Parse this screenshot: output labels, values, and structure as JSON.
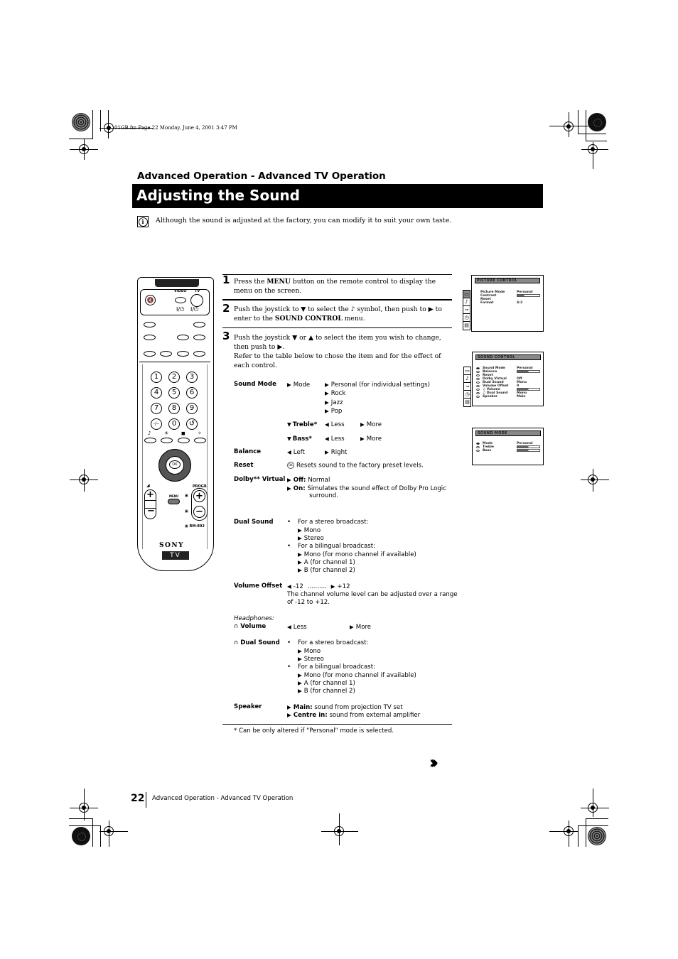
{
  "file_info": "01GB.fm  Page 22  Monday, June 4, 2001  3:47 PM",
  "section_header": "Advanced Operation - Advanced TV Operation",
  "page_title": "Adjusting the Sound",
  "intro": {
    "icon": "info-icon",
    "text": "Although the sound is adjusted at the factory, you can modify it to suit your own taste."
  },
  "steps": [
    {
      "num": "1",
      "pre": "Press the ",
      "bold": "MENU",
      "post": " button on the remote control to display the menu on the screen."
    },
    {
      "num": "2",
      "pre": "Push the joystick to ▼ to select the ♪ symbol, then push to ▶ to enter to the ",
      "bold": "SOUND CONTROL",
      "post": " menu."
    },
    {
      "num": "3",
      "line1": "Push the joystick ▼ or ▲ to select the item you wish to change, then push to ▶.",
      "line2": "Refer to the table below to chose the item and for the effect of each control."
    }
  ],
  "table": {
    "sound_mode": {
      "label": "Sound Mode",
      "mode_label": "Mode",
      "mode_options": [
        "Personal (for individual settings)",
        "Rock",
        "Jazz",
        "Pop"
      ],
      "treble_label": "Treble*",
      "bass_label": "Bass*",
      "less": "Less",
      "more": "More"
    },
    "balance": {
      "label": "Balance",
      "left": "Left",
      "right": "Right"
    },
    "reset": {
      "label": "Reset",
      "text": "Resets sound to the factory preset levels."
    },
    "dolby": {
      "label": "Dolby** Virtual",
      "off_key": "Off:",
      "off_text": "Normal",
      "on_key": "On:",
      "on_text": "Simulates the sound effect of Dolby Pro Logic",
      "on_text2": "surround."
    },
    "dual_sound": {
      "label": "Dual Sound",
      "stereo_head": "For a stereo broadcast:",
      "stereo_options": [
        "Mono",
        "Stereo"
      ],
      "bilingual_head": "For a bilingual broadcast:",
      "bilingual_options": [
        "Mono (for mono channel if available)",
        "A (for channel 1)",
        "B (for channel 2)"
      ]
    },
    "volume_offset": {
      "label": "Volume Offset",
      "range_min": "-12",
      "dots": "..........",
      "range_max": "+12",
      "desc1": "The channel volume level can be adjusted over a range",
      "desc2": "of -12 to +12."
    },
    "headphones": {
      "heading": "Headphones:",
      "volume_label": "Volume",
      "less": "Less",
      "more": "More",
      "dual_label": "Dual Sound",
      "stereo_head": "For a stereo broadcast:",
      "stereo_options": [
        "Mono",
        "Stereo"
      ],
      "bilingual_head": "For a bilingual broadcast:",
      "bilingual_options": [
        "Mono (for mono channel if available)",
        "A (for channel 1)",
        "B (for channel 2)"
      ]
    },
    "speaker": {
      "label": "Speaker",
      "main_key": "Main:",
      "main_text": "sound from projection TV set",
      "centre_key": "Centre in:",
      "centre_text": "sound from external amplifier"
    },
    "footnote": "* Can be only altered if \"Personal\" mode is selected."
  },
  "remote": {
    "labels": {
      "video": "VIDEO",
      "tv": "TV",
      "power1": "I/⏻",
      "power2": "I/⏻",
      "menu": "MENU",
      "progr": "PROGR",
      "model": "RM-892",
      "brand": "SONY",
      "tv_badge": "TV",
      "ok": "OK"
    },
    "numbers": [
      "1",
      "2",
      "3",
      "4",
      "5",
      "6",
      "7",
      "8",
      "9",
      "-/--",
      "0",
      "↺"
    ]
  },
  "osd": {
    "picture_control": {
      "title": "PICTURE CONTROL",
      "rows": [
        {
          "label": "Picture Mode",
          "value": "Personal"
        },
        {
          "label": "Contrast",
          "value": "",
          "bar": 0.3
        },
        {
          "label": "Reset",
          "value": ""
        },
        {
          "label": "Format",
          "value": "4:3"
        }
      ]
    },
    "sound_control": {
      "title": "SOUND CONTROL",
      "rows": [
        {
          "label": "Sound Mode",
          "value": "Personal"
        },
        {
          "label": "Balance",
          "value": "",
          "bar": 0.5
        },
        {
          "label": "Reset",
          "value": ""
        },
        {
          "label": "Dolby Virtual",
          "value": "Off"
        },
        {
          "label": "Dual Sound",
          "value": "Mono"
        },
        {
          "label": "Volume Offset",
          "value": "0"
        },
        {
          "label": "♫ Volume",
          "value": "",
          "bar": 0.5
        },
        {
          "label": "♫ Dual Sound",
          "value": "Mono"
        },
        {
          "label": "Speaker",
          "value": "Main"
        }
      ]
    },
    "sound_mode": {
      "title": "SOUND MODE",
      "rows": [
        {
          "label": "Mode",
          "value": "Personal"
        },
        {
          "label": "Treble",
          "value": "",
          "bar": 0.5
        },
        {
          "label": "Bass",
          "value": "",
          "bar": 0.5
        }
      ]
    },
    "side_icons": [
      "picture-icon",
      "sound-icon",
      "connector-icon",
      "timer-icon",
      "setup-icon"
    ]
  },
  "footer": {
    "page_number": "22",
    "text": "Advanced Operation - Advanced TV Operation",
    "continue_icon": "›››"
  }
}
